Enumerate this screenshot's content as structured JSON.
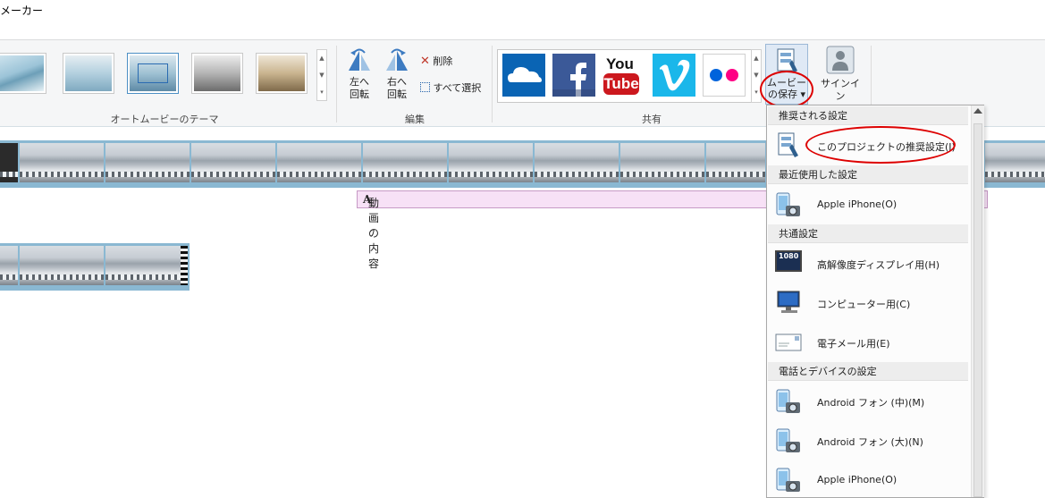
{
  "window": {
    "title": "メーカー"
  },
  "ribbon": {
    "theme_group_label": "オートムービーのテーマ",
    "edit": {
      "group_label": "編集",
      "rotate_left_line1": "左へ",
      "rotate_left_line2": "回転",
      "rotate_right_line1": "右へ",
      "rotate_right_line2": "回転",
      "delete_label": "削除",
      "select_all_label": "すべて選択"
    },
    "share": {
      "group_label": "共有",
      "youtube_top": "You",
      "youtube_bottom": "Tube",
      "icons": [
        "onedrive-icon",
        "facebook-icon",
        "youtube-icon",
        "vimeo-icon",
        "flickr-icon"
      ]
    },
    "save_movie": {
      "line1": "ムービー",
      "line2": "の保存 ▾"
    },
    "sign_in_label": "サインイン"
  },
  "timeline": {
    "caption_label": "動画の内容",
    "caption_prefix": "A"
  },
  "save_menu": {
    "sections": {
      "recommended": "推奨される設定",
      "recent": "最近使用した設定",
      "common": "共通設定",
      "phones": "電話とデバイスの設定"
    },
    "items": {
      "project_recommended": "このプロジェクトの推奨設定(J)",
      "recent_iphone": "Apple iPhone(O)",
      "hd_display": "高解像度ディスプレイ用(H)",
      "computer": "コンピューター用(C)",
      "email": "電子メール用(E)",
      "android_medium": "Android フォン (中)(M)",
      "android_large": "Android フォン (大)(N)",
      "iphone": "Apple iPhone(O)"
    },
    "hd_badge": "1080"
  },
  "colors": {
    "highlight_red": "#dd0000",
    "onedrive": "#0a64b4",
    "facebook": "#3b5998",
    "youtube_red": "#cc181e",
    "vimeo": "#1ab7ea",
    "flickr_blue": "#0063dc",
    "flickr_pink": "#ff0084"
  }
}
